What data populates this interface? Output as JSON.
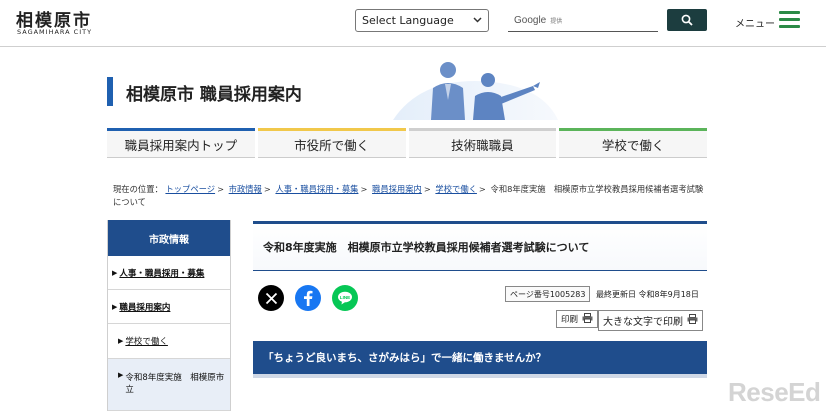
{
  "header": {
    "logo_main": "相模原市",
    "logo_sub": "SAGAMIHARA CITY",
    "language_select": "Select Language",
    "search_brand": "Google",
    "search_brand_sub": "提供",
    "menu_label": "メニュー"
  },
  "banner": {
    "title": "相模原市 職員採用案内"
  },
  "tabs": [
    {
      "label": "職員採用案内トップ"
    },
    {
      "label": "市役所で働く"
    },
    {
      "label": "技術職職員"
    },
    {
      "label": "学校で働く"
    }
  ],
  "breadcrumb": {
    "prefix": "現在の位置：",
    "links": [
      "トップページ",
      "市政情報",
      "人事・職員採用・募集",
      "職員採用案内",
      "学校で働く"
    ],
    "current": "令和8年度実施　相模原市立学校教員採用候補者選考試験について"
  },
  "sidebar": {
    "heading": "市政情報",
    "items": [
      {
        "label": "人事・職員採用・募集"
      },
      {
        "label": "職員採用案内"
      },
      {
        "label": "学校で働く"
      },
      {
        "label": "令和8年度実施　相模原市立"
      }
    ]
  },
  "main": {
    "title": "令和8年度実施　相模原市立学校教員採用候補者選考試験について",
    "page_number": "ページ番号1005283",
    "updated": "最終更新日 令和8年9月18日",
    "print_label": "印刷",
    "print_large_label": "大きな文字で印刷",
    "section_heading": "「ちょうど良いまち、さがみはら」で一緒に働きませんか？"
  },
  "share": {
    "icons": [
      "x-icon",
      "facebook-icon",
      "line-icon"
    ]
  },
  "colors": {
    "primary_blue": "#1f4d8c",
    "accent_green": "#2b8a46",
    "search_button": "#1c3d3f"
  },
  "watermark": "ReseEd"
}
